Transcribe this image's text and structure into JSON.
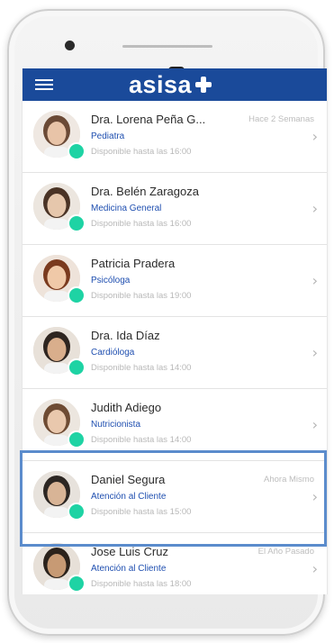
{
  "app": {
    "logo_text": "asisa",
    "bar_color": "#1a4a9a",
    "status_color": "#1ed3a4",
    "highlight_color": "#5b8ccc"
  },
  "contacts": [
    {
      "name": "Dra. Lorena Peña G...",
      "specialty": "Pediatra",
      "availability": "Disponible hasta las 16:00",
      "time": "Hace 2 Semanas",
      "online": true
    },
    {
      "name": "Dra. Belén Zaragoza",
      "specialty": "Medicina General",
      "availability": "Disponible hasta las 16:00",
      "time": "",
      "online": true
    },
    {
      "name": "Patricia Pradera",
      "specialty": "Psicóloga",
      "availability": "Disponible hasta las 19:00",
      "time": "",
      "online": true
    },
    {
      "name": "Dra. Ida Díaz",
      "specialty": "Cardióloga",
      "availability": "Disponible hasta las 14:00",
      "time": "",
      "online": true
    },
    {
      "name": "Judith Adiego",
      "specialty": "Nutricionista",
      "availability": "Disponible hasta las 14:00",
      "time": "",
      "online": true
    },
    {
      "name": "Daniel Segura",
      "specialty": "Atención al Cliente",
      "availability": "Disponible hasta las 15:00",
      "time": "Ahora Mismo",
      "online": true
    },
    {
      "name": "Jose Luis Cruz",
      "specialty": "Atención al Cliente",
      "availability": "Disponible hasta las 18:00",
      "time": "El Año Pasado",
      "online": true
    }
  ]
}
